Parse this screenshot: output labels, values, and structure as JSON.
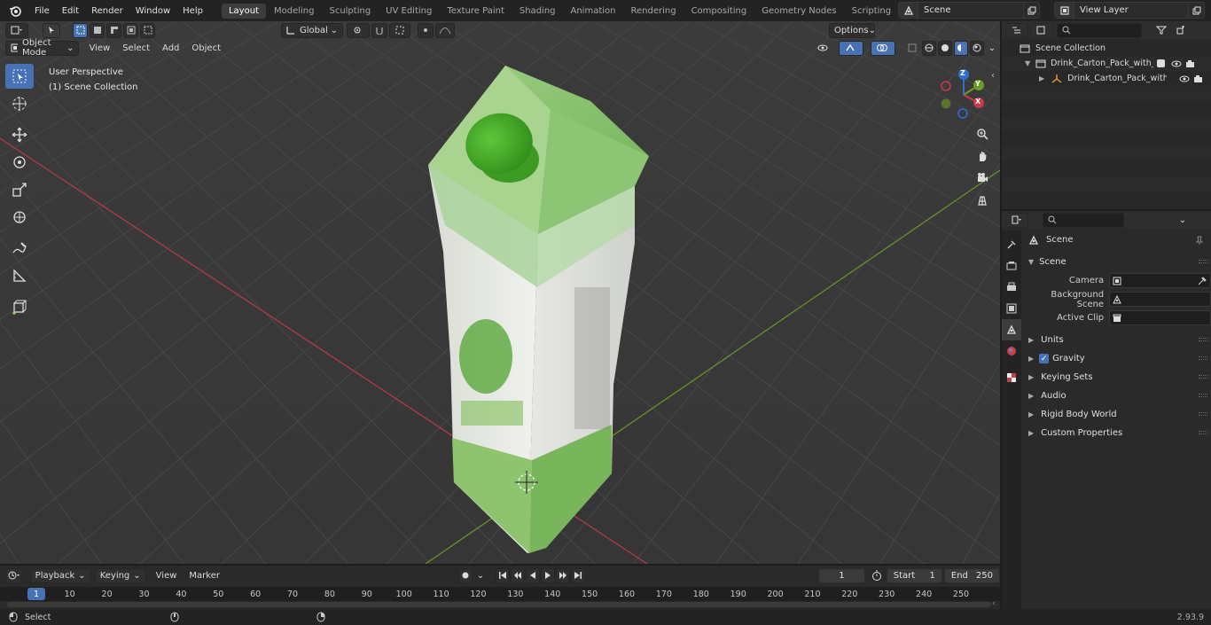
{
  "topbar": {
    "menus": [
      "File",
      "Edit",
      "Render",
      "Window",
      "Help"
    ],
    "workspaces": [
      "Layout",
      "Modeling",
      "Sculpting",
      "UV Editing",
      "Texture Paint",
      "Shading",
      "Animation",
      "Rendering",
      "Compositing",
      "Geometry Nodes",
      "Scripting"
    ],
    "active_workspace": "Layout",
    "scene_name": "Scene",
    "view_layer_name": "View Layer"
  },
  "viewport": {
    "mode": "Object Mode",
    "menus": [
      "View",
      "Select",
      "Add",
      "Object"
    ],
    "orientation": "Global",
    "options_label": "Options",
    "perspective_label": "User Perspective",
    "collection_label": "(1) Scene Collection",
    "gizmo_axes": {
      "x": "X",
      "y": "Y",
      "z": "Z"
    },
    "colors": {
      "x_axis": "#c93a4a",
      "y_axis": "#6c9c24",
      "z_axis": "#2c6fd1",
      "selection": "#4772b3"
    }
  },
  "outliner": {
    "root": "Scene Collection",
    "rows": [
      {
        "label": "Drink_Carton_Pack_with_Scre",
        "level": 1
      },
      {
        "label": "Drink_Carton_Pack_with_",
        "level": 2
      }
    ]
  },
  "properties": {
    "context_title": "Scene",
    "section": "Scene",
    "fields": [
      {
        "label": "Camera"
      },
      {
        "label": "Background Scene"
      },
      {
        "label": "Active Clip"
      }
    ],
    "panels": [
      "Units",
      "Gravity",
      "Keying Sets",
      "Audio",
      "Rigid Body World",
      "Custom Properties"
    ],
    "gravity_checked": true
  },
  "timeline": {
    "menus": [
      "Playback",
      "Keying",
      "View",
      "Marker"
    ],
    "current_frame": "1",
    "start_label": "Start",
    "start": "1",
    "end_label": "End",
    "end": "250",
    "ticks": [
      "1",
      "10",
      "20",
      "30",
      "40",
      "50",
      "60",
      "70",
      "80",
      "90",
      "100",
      "110",
      "120",
      "130",
      "140",
      "150",
      "160",
      "170",
      "180",
      "190",
      "200",
      "210",
      "220",
      "230",
      "240",
      "250"
    ]
  },
  "statusbar": {
    "hint": "Select",
    "version": "2.93.9"
  }
}
